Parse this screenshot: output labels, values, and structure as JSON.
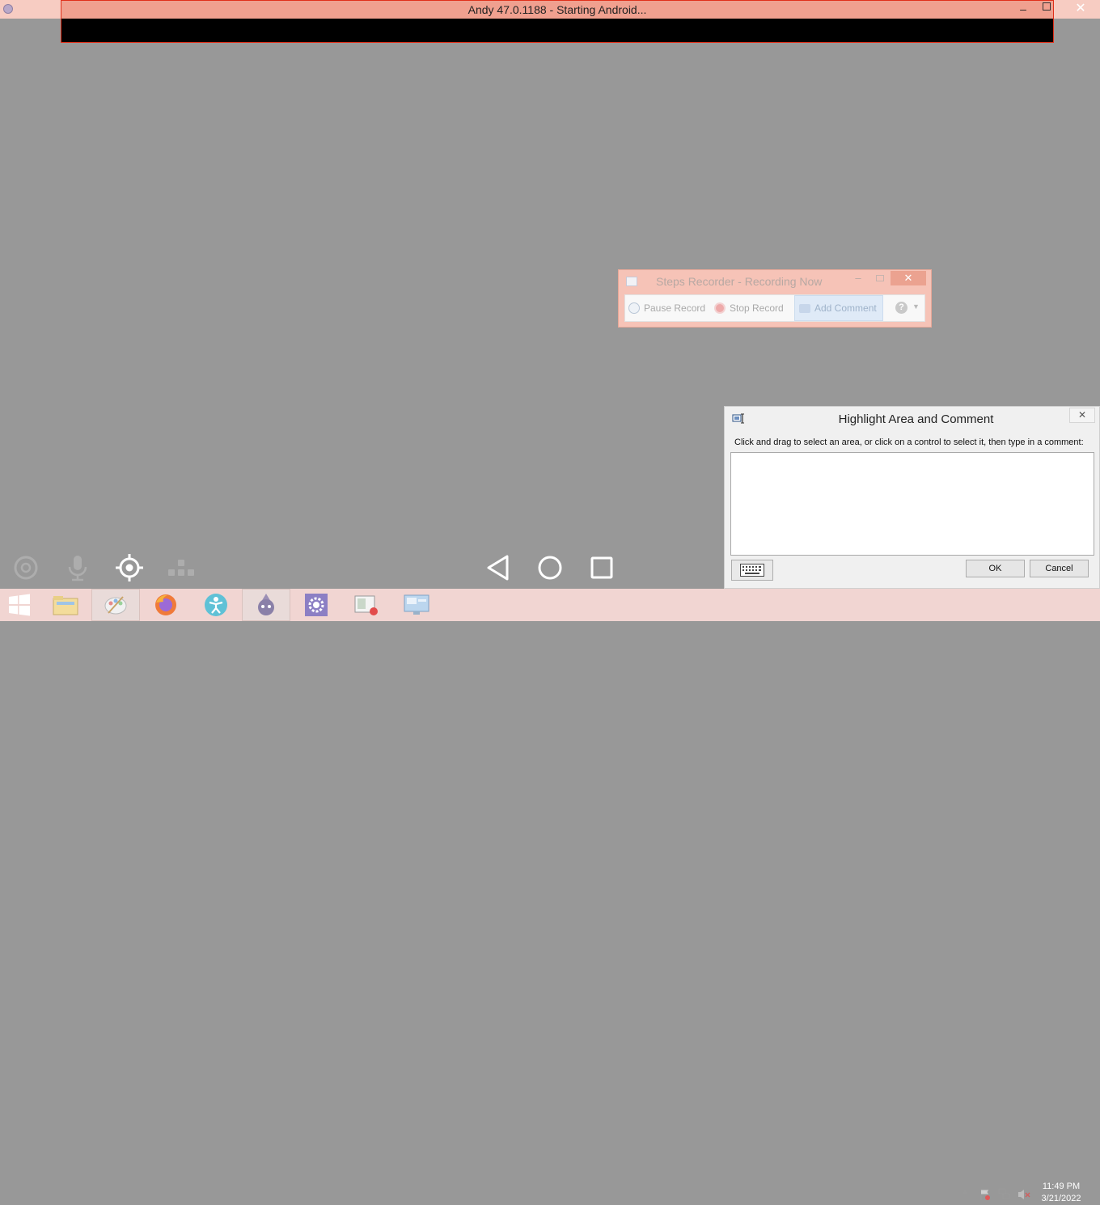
{
  "andy_window": {
    "title": "Andy 47.0.1188 - Starting Android...",
    "minimize_glyph": "–",
    "close_glyph": "✕"
  },
  "android_controls": {
    "left_icons": [
      "camera-icon",
      "microphone-icon",
      "gps-target-icon",
      "keymap-icon"
    ],
    "nav_icons": [
      "back-icon",
      "home-icon",
      "recents-icon"
    ]
  },
  "steps_recorder": {
    "title": "Steps Recorder - Recording Now",
    "minimize_glyph": "–",
    "close_glyph": "✕",
    "pause_label": "Pause Record",
    "stop_label": "Stop Record",
    "add_comment_label": "Add Comment",
    "help_glyph": "?",
    "dropdown_glyph": "▼"
  },
  "highlight_dialog": {
    "title": "Highlight Area and Comment",
    "close_glyph": "✕",
    "instruction": "Click and drag to select an area, or click on a control to select it, then type in a comment:",
    "comment_value": "",
    "ok_label": "OK",
    "cancel_label": "Cancel"
  },
  "taskbar": {
    "items": [
      "start-button",
      "file-explorer",
      "paint",
      "firefox",
      "accessibility-app",
      "andy-app",
      "settings",
      "screen-recorder",
      "remote-desktop"
    ],
    "tray": {
      "arrow_glyph": "▲",
      "clock_time": "11:49 PM",
      "clock_date": "3/21/2022"
    }
  },
  "colors": {
    "desktop": "#989898",
    "andy_titlebar": "#f0a08f",
    "andy_border": "#e0301a",
    "steps_bg": "#f6c3b7",
    "taskbar": "#f1d5d2"
  }
}
